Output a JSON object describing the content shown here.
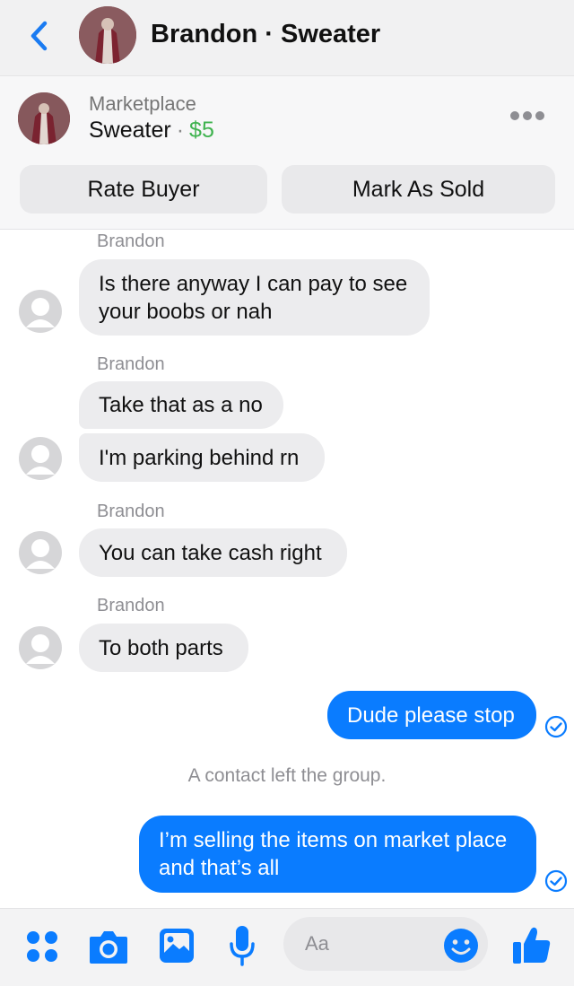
{
  "header": {
    "title": "Brandon · Sweater"
  },
  "product": {
    "source": "Marketplace",
    "name": "Sweater",
    "separator": "·",
    "price": "$5"
  },
  "actions": {
    "rate_buyer": "Rate Buyer",
    "mark_sold": "Mark As Sold"
  },
  "messages": [
    {
      "sender": "Brandon",
      "text": "Is there anyway I can pay to see your boobs or nah"
    },
    {
      "sender": "Brandon",
      "text": "Take that as a no"
    },
    {
      "text": "I'm parking behind rn"
    },
    {
      "sender": "Brandon",
      "text": "You can take cash right"
    },
    {
      "sender": "Brandon",
      "text": "To both parts"
    },
    {
      "text": "Dude please stop",
      "outgoing": true
    },
    {
      "system": "A contact left the group."
    },
    {
      "text": "I’m selling the items on market place and that’s all",
      "outgoing": true
    }
  ],
  "composer": {
    "placeholder": "Aa"
  },
  "colors": {
    "accent": "#0a7cff",
    "price": "#3fb34f",
    "incoming_bubble": "#ececee"
  }
}
